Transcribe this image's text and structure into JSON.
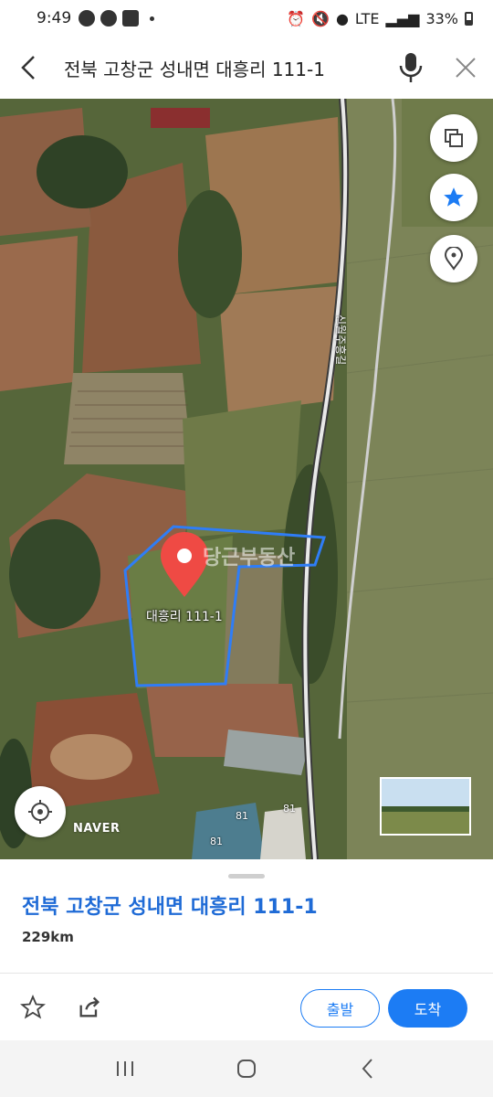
{
  "status_bar": {
    "time": "9:49",
    "network": "LTE",
    "battery": "33%"
  },
  "header": {
    "title": "전북 고창군 성내면 대흥리 111-1"
  },
  "map": {
    "marker_label": "대흥리 111-1",
    "watermark": "당근부동산",
    "road_label": "신월주흥길",
    "provider_logo": "NAVER",
    "building_numbers": [
      "81",
      "81",
      "81"
    ],
    "colors": {
      "parcel_outline": "#2f7df6",
      "marker": "#ef4a44"
    }
  },
  "sheet": {
    "address": "전북 고창군 성내면 대흥리 111-1",
    "distance": "229km",
    "depart_label": "출발",
    "arrive_label": "도착"
  },
  "accent_color": "#1c7cf4"
}
